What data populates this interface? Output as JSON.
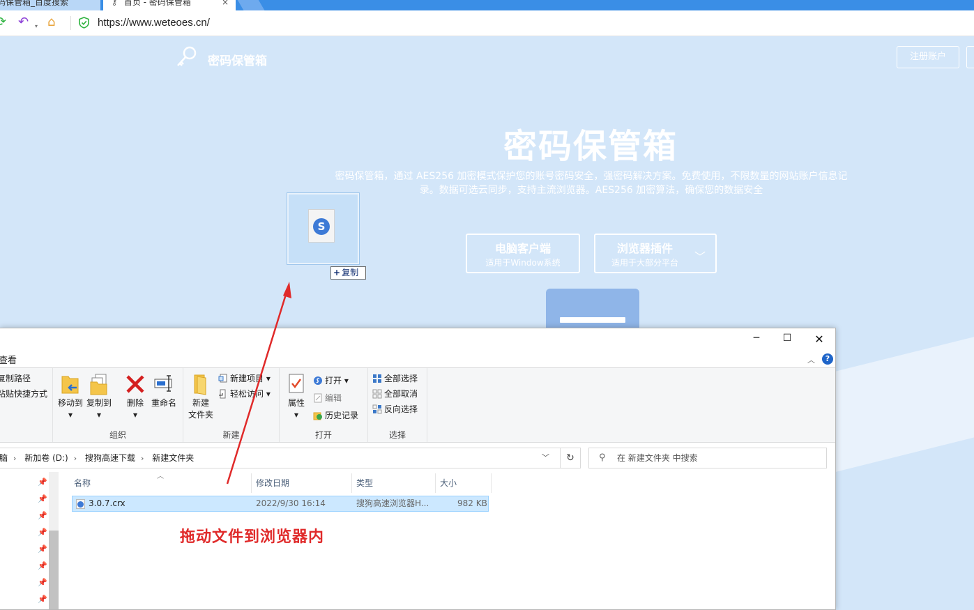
{
  "browser": {
    "tabs": [
      {
        "label": "码保管箱_百度搜索",
        "active": false
      },
      {
        "label": "首页 - 密码保管箱",
        "active": true
      }
    ],
    "close_glyph": "×",
    "url": "https://www.weteoes.cn/"
  },
  "webpage": {
    "brand": "密码保管箱",
    "register_label": "注册账户",
    "hero_title": "密码保管箱",
    "hero_desc": "密码保管箱，通过 AES256 加密模式保护您的账号密码安全，强密码解决方案。免费使用，不限数量的网站账户信息记录。数据可选云同步，支持主流浏览器。AES256 加密算法，确保您的数据安全",
    "download_pc": {
      "title": "电脑客户端",
      "subtitle": "适用于Window系统"
    },
    "download_plugin": {
      "title": "浏览器插件",
      "subtitle": "适用于大部分平台"
    }
  },
  "drag": {
    "badge_plus": "+",
    "badge_label": "复制"
  },
  "explorer": {
    "ribbon_tab": "查看",
    "window_controls": {
      "minimize": "─",
      "maximize": "☐",
      "close": "✕"
    },
    "groups": {
      "clipboard": {
        "copy_path": "复制路径",
        "paste_shortcut": "粘贴快捷方式"
      },
      "organize": {
        "label": "组织",
        "move_to": "移动到",
        "copy_to": "复制到",
        "delete": "删除",
        "rename": "重命名"
      },
      "new": {
        "label": "新建",
        "new_folder_line1": "新建",
        "new_folder_line2": "文件夹",
        "new_item": "新建项目",
        "easy_access": "轻松访问"
      },
      "open": {
        "label": "打开",
        "properties": "属性",
        "open": "打开",
        "edit": "编辑",
        "history": "历史记录"
      },
      "select": {
        "label": "选择",
        "select_all": "全部选择",
        "select_none": "全部取消",
        "invert": "反向选择"
      }
    },
    "breadcrumb": [
      "脑",
      "新加卷 (D:)",
      "搜狗高速下载",
      "新建文件夹"
    ],
    "search_placeholder": "在 新建文件夹 中搜索",
    "columns": [
      "名称",
      "修改日期",
      "类型",
      "大小"
    ],
    "files": [
      {
        "name": "3.0.7.crx",
        "modified": "2022/9/30 16:14",
        "type": "搜狗高速浏览器H...",
        "size": "982 KB"
      }
    ]
  },
  "annotation": {
    "text": "拖动文件到浏览器内",
    "color": "#e02a2a"
  }
}
